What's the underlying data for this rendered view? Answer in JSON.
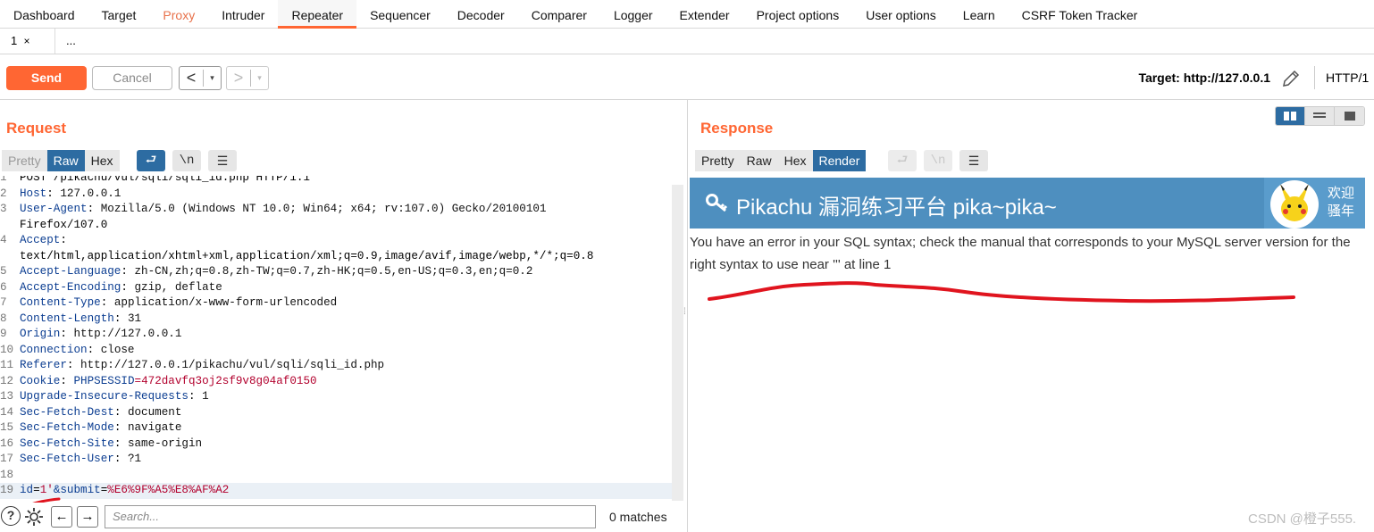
{
  "nav": {
    "tabs": [
      "Dashboard",
      "Target",
      "Proxy",
      "Intruder",
      "Repeater",
      "Sequencer",
      "Decoder",
      "Comparer",
      "Logger",
      "Extender",
      "Project options",
      "User options",
      "Learn",
      "CSRF Token Tracker"
    ],
    "active": "Repeater"
  },
  "subtabs": {
    "tab1": "1",
    "tab1_close": "×",
    "more": "..."
  },
  "toolbar": {
    "send": "Send",
    "cancel": "Cancel",
    "back": "<",
    "forward": ">",
    "dropdown": "▾",
    "target": "Target: http://127.0.0.1",
    "http": "HTTP/1"
  },
  "request": {
    "title": "Request",
    "tabs": [
      "Pretty",
      "Raw",
      "Hex"
    ],
    "selected": "Raw",
    "wrap_icon": "⮐",
    "newline_icon": "\\n",
    "menu_icon": "☰",
    "lines": [
      {
        "n": "1",
        "name": "",
        "value": "POST /pikachu/vul/sqli/sqli_id.php HTTP/1.1"
      },
      {
        "n": "2",
        "name": "Host",
        "value": "127.0.0.1"
      },
      {
        "n": "3",
        "name": "User-Agent",
        "value": "Mozilla/5.0 (Windows NT 10.0; Win64; x64; rv:107.0) Gecko/20100101"
      },
      {
        "n": "",
        "name": "",
        "value": "Firefox/107.0"
      },
      {
        "n": "4",
        "name": "Accept",
        "value": ""
      },
      {
        "n": "",
        "name": "",
        "value": "text/html,application/xhtml+xml,application/xml;q=0.9,image/avif,image/webp,*/*;q=0.8"
      },
      {
        "n": "5",
        "name": "Accept-Language",
        "value": "zh-CN,zh;q=0.8,zh-TW;q=0.7,zh-HK;q=0.5,en-US;q=0.3,en;q=0.2"
      },
      {
        "n": "6",
        "name": "Accept-Encoding",
        "value": "gzip, deflate"
      },
      {
        "n": "7",
        "name": "Content-Type",
        "value": "application/x-www-form-urlencoded"
      },
      {
        "n": "8",
        "name": "Content-Length",
        "value": "31"
      },
      {
        "n": "9",
        "name": "Origin",
        "value": "http://127.0.0.1"
      },
      {
        "n": "10",
        "name": "Connection",
        "value": "close"
      },
      {
        "n": "11",
        "name": "Referer",
        "value": "http://127.0.0.1/pikachu/vul/sqli/sqli_id.php"
      },
      {
        "n": "12",
        "name": "Cookie",
        "value": "PHPSESSID=472davfq3oj2sf9v8g04af0150"
      },
      {
        "n": "13",
        "name": "Upgrade-Insecure-Requests",
        "value": "1"
      },
      {
        "n": "14",
        "name": "Sec-Fetch-Dest",
        "value": "document"
      },
      {
        "n": "15",
        "name": "Sec-Fetch-Mode",
        "value": "navigate"
      },
      {
        "n": "16",
        "name": "Sec-Fetch-Site",
        "value": "same-origin"
      },
      {
        "n": "17",
        "name": "Sec-Fetch-User",
        "value": "?1"
      },
      {
        "n": "18",
        "name": "",
        "value": ""
      }
    ],
    "body_line": {
      "n": "19",
      "p1": "id",
      "v1": "1'",
      "amp": "&",
      "p2": "submit",
      "v2": "%E6%9F%A5%E8%AF%A2"
    }
  },
  "search": {
    "help": "?",
    "placeholder": "Search...",
    "matches": "0 matches",
    "prev": "←",
    "next": "→"
  },
  "response": {
    "title": "Response",
    "tabs": [
      "Pretty",
      "Raw",
      "Hex",
      "Render"
    ],
    "selected": "Render",
    "render": {
      "site_title": "Pikachu 漏洞练习平台 pika~pika~",
      "welcome": "欢迎\n骚年",
      "error": "You have an error in your SQL syntax; check the manual that corresponds to your MySQL server version for the right syntax to use near ''' at line 1"
    }
  },
  "watermark": "CSDN @橙子555.",
  "colors": {
    "accent": "#ff6633",
    "selected_tab": "#2d6ca2",
    "header_blue": "#4e8fbf",
    "annotation_red": "#e0141e"
  }
}
